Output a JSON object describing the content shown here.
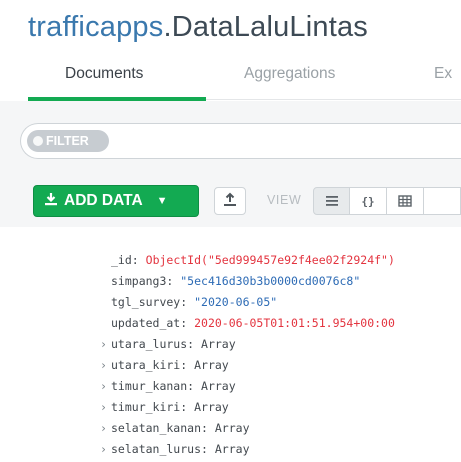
{
  "header": {
    "database": "trafficapps",
    "separator": ".",
    "collection": "DataLaluLintas"
  },
  "tabs": [
    {
      "label": "Documents",
      "active": true
    },
    {
      "label": "Aggregations",
      "active": false
    },
    {
      "label": "Ex",
      "active": false
    }
  ],
  "filter": {
    "label": "FILTER"
  },
  "toolbar": {
    "add_data_label": "ADD DATA",
    "view_label": "VIEW",
    "add_icon": "download-icon",
    "caret_icon": "caret-down-icon",
    "export_icon": "export-icon",
    "view_list_icon": "list-view-icon",
    "view_json": "{}",
    "view_table_icon": "table-view-icon"
  },
  "document": {
    "fields": [
      {
        "key": "_id",
        "value": "ObjectId(\"5ed999457e92f4ee02f2924f\")",
        "type": "objectid",
        "expandable": false
      },
      {
        "key": "simpang3",
        "value": "\"5ec416d30b3b0000cd0076c8\"",
        "type": "string",
        "expandable": false
      },
      {
        "key": "tgl_survey",
        "value": "\"2020-06-05\"",
        "type": "string",
        "expandable": false
      },
      {
        "key": "updated_at",
        "value": "2020-06-05T01:01:51.954+00:00",
        "type": "date",
        "expandable": false
      },
      {
        "key": "utara_lurus",
        "value": "Array",
        "type": "array",
        "expandable": true
      },
      {
        "key": "utara_kiri",
        "value": "Array",
        "type": "array",
        "expandable": true
      },
      {
        "key": "timur_kanan",
        "value": "Array",
        "type": "array",
        "expandable": true
      },
      {
        "key": "timur_kiri",
        "value": "Array",
        "type": "array",
        "expandable": true
      },
      {
        "key": "selatan_kanan",
        "value": "Array",
        "type": "array",
        "expandable": true
      },
      {
        "key": "selatan_lurus",
        "value": "Array",
        "type": "array",
        "expandable": true
      }
    ]
  },
  "colors": {
    "accent_green": "#13aa52",
    "title_db": "#3a78ad",
    "value_red": "#e3343f",
    "value_blue": "#2d6bb5"
  }
}
